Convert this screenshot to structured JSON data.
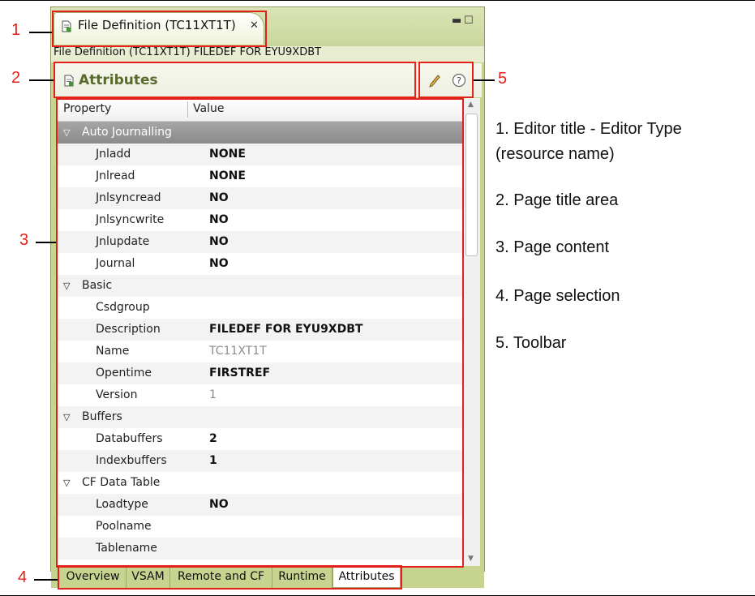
{
  "editor": {
    "tab_title": "File Definition (TC11XT1T)",
    "breadcrumb": "File Definition (TC11XT1T) FILEDEF FOR EYU9XDBT",
    "page_title": "Attributes"
  },
  "table": {
    "headers": [
      "Property",
      "Value"
    ],
    "rows": [
      {
        "kind": "category",
        "label": "Auto Journalling",
        "selected": true
      },
      {
        "kind": "prop",
        "name": "Jnladd",
        "value": "NONE",
        "readonly": false
      },
      {
        "kind": "prop",
        "name": "Jnlread",
        "value": "NONE",
        "readonly": false
      },
      {
        "kind": "prop",
        "name": "Jnlsyncread",
        "value": "NO",
        "readonly": false
      },
      {
        "kind": "prop",
        "name": "Jnlsyncwrite",
        "value": "NO",
        "readonly": false
      },
      {
        "kind": "prop",
        "name": "Jnlupdate",
        "value": "NO",
        "readonly": false
      },
      {
        "kind": "prop",
        "name": "Journal",
        "value": "NO",
        "readonly": false
      },
      {
        "kind": "category",
        "label": "Basic",
        "selected": false
      },
      {
        "kind": "prop",
        "name": "Csdgroup",
        "value": "",
        "readonly": false
      },
      {
        "kind": "prop",
        "name": "Description",
        "value": "FILEDEF FOR EYU9XDBT",
        "readonly": false
      },
      {
        "kind": "prop",
        "name": "Name",
        "value": "TC11XT1T",
        "readonly": true
      },
      {
        "kind": "prop",
        "name": "Opentime",
        "value": "FIRSTREF",
        "readonly": false
      },
      {
        "kind": "prop",
        "name": "Version",
        "value": "1",
        "readonly": true
      },
      {
        "kind": "category",
        "label": "Buffers",
        "selected": false
      },
      {
        "kind": "prop",
        "name": "Databuffers",
        "value": "2",
        "readonly": false
      },
      {
        "kind": "prop",
        "name": "Indexbuffers",
        "value": "1",
        "readonly": false
      },
      {
        "kind": "category",
        "label": "CF Data Table",
        "selected": false
      },
      {
        "kind": "prop",
        "name": "Loadtype",
        "value": "NO",
        "readonly": false
      },
      {
        "kind": "prop",
        "name": "Poolname",
        "value": "",
        "readonly": false
      },
      {
        "kind": "prop",
        "name": "Tablename",
        "value": "",
        "readonly": false
      }
    ]
  },
  "page_tabs": [
    {
      "label": "Overview",
      "active": false
    },
    {
      "label": "VSAM",
      "active": false
    },
    {
      "label": "Remote and CF",
      "active": false
    },
    {
      "label": "Runtime",
      "active": false
    },
    {
      "label": "Attributes",
      "active": true
    }
  ],
  "callouts": [
    "1",
    "2",
    "3",
    "4",
    "5"
  ],
  "legend": [
    "1. Editor title - Editor Type",
    "(resource name)",
    "2. Page title area",
    "3. Page content",
    "4. Page selection",
    "5. Toolbar"
  ],
  "icons": {
    "tab": "document-icon",
    "page": "document-icon",
    "close": "close-icon",
    "minimize": "minimize-icon",
    "maximize": "maximize-icon",
    "edit": "pencil-icon",
    "help": "help-icon",
    "expand": "triangle-down-icon"
  },
  "colors": {
    "callout_red": "#e32119",
    "page_title_green": "#5a6b2e",
    "editor_frame": "#c6d48f"
  }
}
